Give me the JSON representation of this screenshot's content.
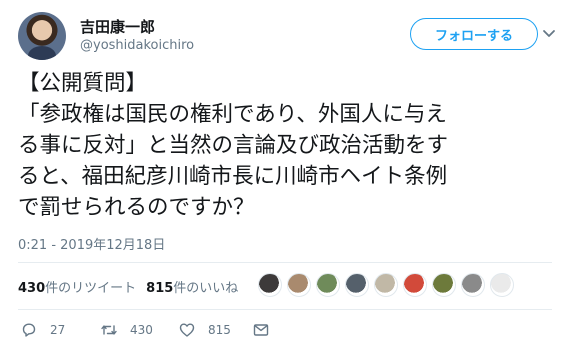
{
  "user": {
    "name": "吉田康一郎",
    "handle": "@yoshidakoichiro"
  },
  "follow_button": {
    "label": "フォローする"
  },
  "tweet": {
    "lines": [
      "【公開質問】",
      "「参政権は国民の権利であり、外国人に与え",
      "る事に反対」と当然の言論及び政治活動をす",
      "ると、福田紀彦川崎市長に川崎市ヘイト条例",
      "で罰せられるのですか？"
    ],
    "timestamp": "0:21 - 2019年12月18日"
  },
  "stats": {
    "retweets_count": "430",
    "retweets_label": "件のリツイート",
    "likes_count": "815",
    "likes_label": "件のいいね"
  },
  "likers": {
    "colors": [
      "#3d3a3a",
      "#a98a6e",
      "#6f8b5a",
      "#55606b",
      "#c1b8a6",
      "#d24a3a",
      "#6d7a3b",
      "#8a8a8a",
      "#eaeaea"
    ]
  },
  "actions": {
    "replies": "27",
    "retweets": "430",
    "likes": "815"
  },
  "icons": {
    "caret": "chevron-down-icon",
    "reply": "reply-icon",
    "retweet": "retweet-icon",
    "like": "heart-icon",
    "dm": "envelope-icon"
  }
}
